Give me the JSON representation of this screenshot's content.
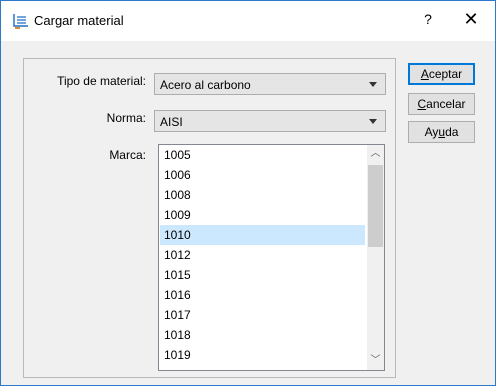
{
  "window": {
    "title": "Cargar material",
    "help_glyph": "?",
    "close_glyph": "✕",
    "icon": "material-load-icon"
  },
  "form": {
    "material_type": {
      "label": "Tipo de material:",
      "value": "Acero al carbono"
    },
    "standard": {
      "label": "Norma:",
      "value": "AISI"
    },
    "brand": {
      "label": "Marca:",
      "items": [
        "1005",
        "1006",
        "1008",
        "1009",
        "1010",
        "1012",
        "1015",
        "1016",
        "1017",
        "1018",
        "1019"
      ],
      "selected": "1010"
    }
  },
  "buttons": {
    "accept": {
      "pre": "",
      "mnemonic": "A",
      "post": "ceptar"
    },
    "cancel": {
      "pre": "",
      "mnemonic": "C",
      "post": "ancelar"
    },
    "help": {
      "pre": "Ay",
      "mnemonic": "u",
      "post": "da"
    }
  },
  "colors": {
    "selection": "#cce8ff",
    "accent": "#0078d7"
  }
}
